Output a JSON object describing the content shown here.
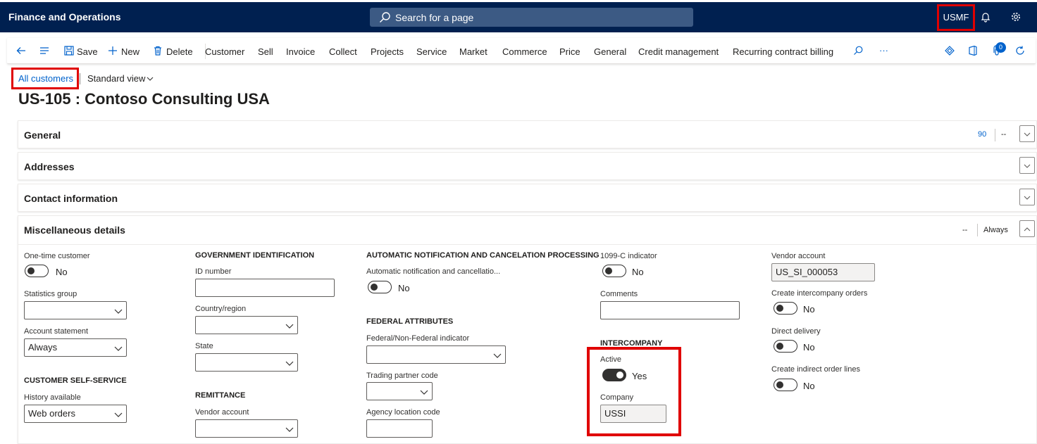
{
  "app": {
    "title": "Finance and Operations",
    "search_placeholder": "Search for a page",
    "company": "USMF"
  },
  "actions": {
    "save": "Save",
    "new": "New",
    "delete": "Delete",
    "menus": [
      "Customer",
      "Sell",
      "Invoice",
      "Collect",
      "Projects",
      "Service",
      "Market",
      "Commerce",
      "Price",
      "General",
      "Credit management",
      "Recurring contract billing"
    ],
    "more": "···",
    "notification_count": "0"
  },
  "breadcrumb": {
    "link": "All customers",
    "view": "Standard view"
  },
  "page": {
    "title": "US-105 : Contoso Consulting USA"
  },
  "fasttabs": {
    "general": {
      "title": "General",
      "summary_1": "90",
      "summary_2": "--"
    },
    "addresses": {
      "title": "Addresses"
    },
    "contact": {
      "title": "Contact information"
    },
    "misc": {
      "title": "Miscellaneous details",
      "summary_1": "--",
      "summary_2": "Always"
    }
  },
  "misc": {
    "col1": {
      "one_time_label": "One-time customer",
      "one_time_value": "No",
      "stats_group_label": "Statistics group",
      "stats_group_value": "",
      "account_statement_label": "Account statement",
      "account_statement_value": "Always",
      "self_service_group": "CUSTOMER SELF-SERVICE",
      "history_label": "History available",
      "history_value": "Web orders"
    },
    "col2": {
      "gov_group": "GOVERNMENT IDENTIFICATION",
      "id_label": "ID number",
      "id_value": "",
      "country_label": "Country/region",
      "country_value": "",
      "state_label": "State",
      "state_value": "",
      "remit_group": "REMITTANCE",
      "vendor_label": "Vendor account",
      "vendor_value": ""
    },
    "col3": {
      "auto_group": "AUTOMATIC NOTIFICATION AND CANCELATION PROCESSING",
      "auto_label": "Automatic notification and cancellatio...",
      "auto_value": "No",
      "federal_group": "FEDERAL ATTRIBUTES",
      "federal_label": "Federal/Non-Federal indicator",
      "federal_value": "",
      "trading_label": "Trading partner code",
      "trading_value": "",
      "agency_label": "Agency location code",
      "agency_value": ""
    },
    "col4": {
      "c1099_label": "1099-C indicator",
      "c1099_value": "No",
      "comments_label": "Comments",
      "comments_value": "",
      "ic_group": "INTERCOMPANY",
      "active_label": "Active",
      "active_value": "Yes",
      "company_label": "Company",
      "company_value": "USSI"
    },
    "col5": {
      "vendor_label": "Vendor account",
      "vendor_value": "US_SI_000053",
      "ic_orders_label": "Create intercompany orders",
      "ic_orders_value": "No",
      "direct_label": "Direct delivery",
      "direct_value": "No",
      "indirect_label": "Create indirect order lines",
      "indirect_value": "No"
    }
  },
  "colors": {
    "nav": "#002050",
    "search": "#3c5a84",
    "link": "#0062cc",
    "highlight": "#e00000"
  }
}
